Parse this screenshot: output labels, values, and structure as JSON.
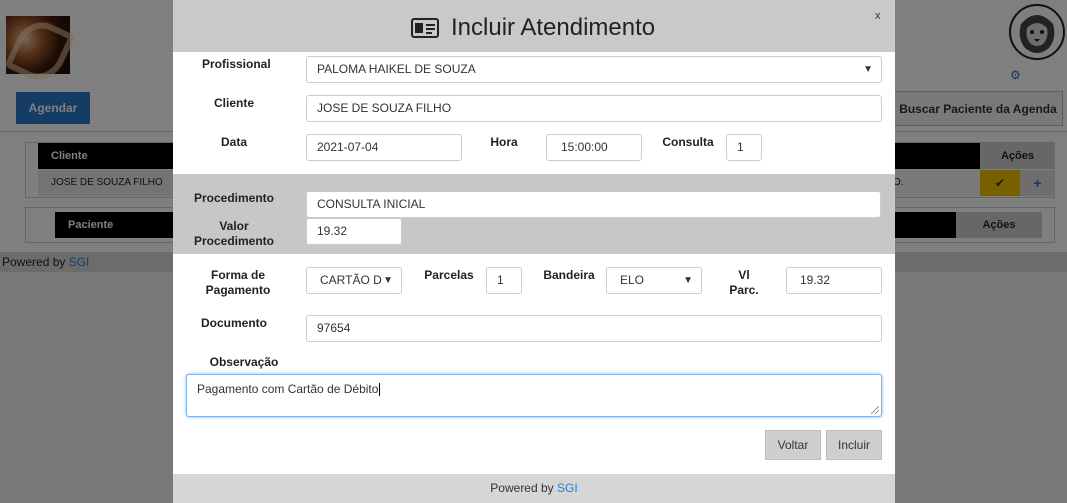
{
  "background": {
    "agendar_label": "Agendar",
    "search_button_label": "Buscar Paciente da Agenda",
    "table1": {
      "header_cliente": "Cliente",
      "header_acoes": "Ações",
      "row_cliente": "JOSE DE SOUZA FILHO",
      "row_partial": "O."
    },
    "table2": {
      "header_paciente": "Paciente",
      "header_acoes": "Ações"
    },
    "footer_prefix": "Powered by",
    "footer_link": "SGI"
  },
  "modal": {
    "title": "Incluir Atendimento",
    "close_label": "x",
    "profissional": {
      "label": "Profissional",
      "value": "PALOMA HAIKEL DE SOUZA"
    },
    "cliente": {
      "label": "Cliente",
      "value": "JOSE DE SOUZA FILHO"
    },
    "data": {
      "label": "Data",
      "value": "2021-07-04"
    },
    "hora": {
      "label": "Hora",
      "value": "15:00:00"
    },
    "consulta": {
      "label": "Consulta",
      "value": "1"
    },
    "procedimento": {
      "label": "Procedimento",
      "value": "CONSULTA INICIAL"
    },
    "valor_procedimento": {
      "label_line1": "Valor",
      "label_line2": "Procedimento",
      "value": "19.32"
    },
    "forma_pagamento": {
      "label_line1": "Forma de",
      "label_line2": "Pagamento",
      "value": "CARTÃO D"
    },
    "parcelas": {
      "label": "Parcelas",
      "value": "1"
    },
    "bandeira": {
      "label": "Bandeira",
      "value": "ELO"
    },
    "vl_parc": {
      "label_line1": "Vl",
      "label_line2": "Parc.",
      "value": "19.32"
    },
    "documento": {
      "label": "Documento",
      "value": "97654"
    },
    "observacao": {
      "label": "Observação",
      "value": "Pagamento com Cartão de Débito"
    },
    "voltar_label": "Voltar",
    "incluir_label": "Incluir",
    "footer_prefix": "Powered by",
    "footer_link": "SGI"
  },
  "colors": {
    "primary": "#2a78c8",
    "link": "#2a7bd6",
    "header_gray": "#c9c9c9",
    "band_gray": "#c7c7c7",
    "action_yellow": "#f0c000"
  },
  "icons": {
    "title_icon": "id-card-icon",
    "dropdown": "chevron-down-icon",
    "settings": "gear-icon",
    "confirm": "check-icon",
    "add": "plus-icon"
  }
}
